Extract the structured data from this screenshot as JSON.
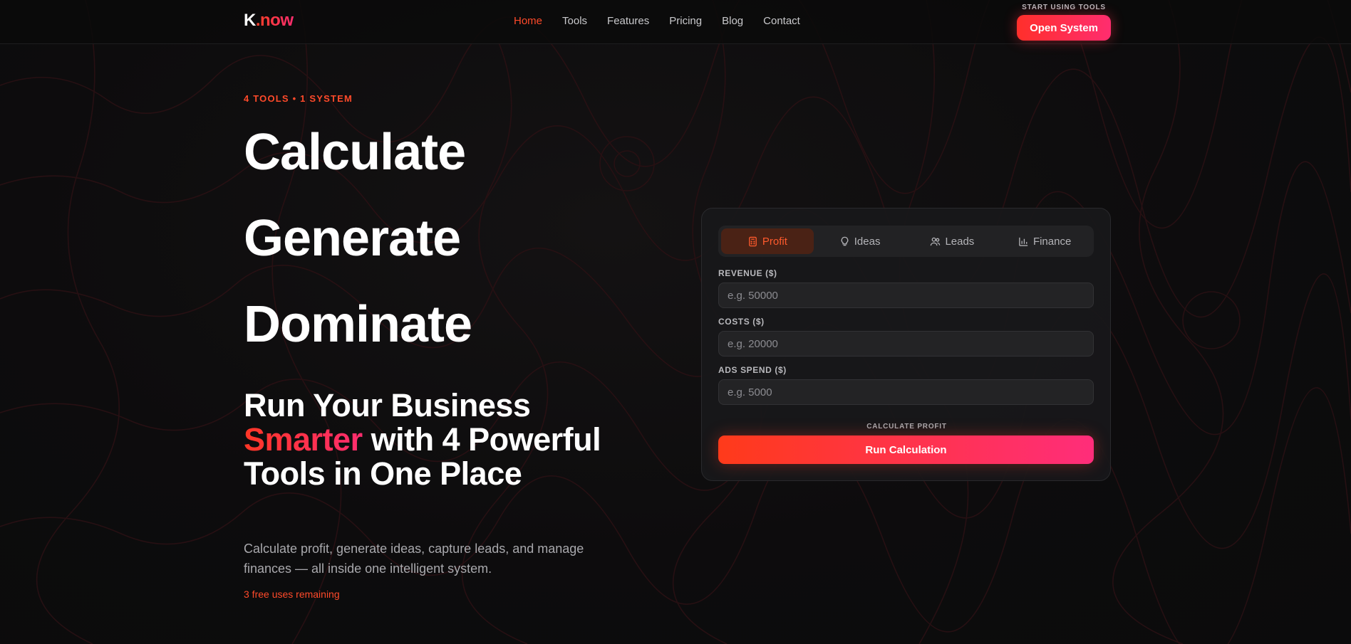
{
  "nav": {
    "logo": {
      "k": "K",
      "dot": ".",
      "now": "now"
    },
    "links": [
      {
        "label": "Home",
        "active": true
      },
      {
        "label": "Tools",
        "active": false
      },
      {
        "label": "Features",
        "active": false
      },
      {
        "label": "Pricing",
        "active": false
      },
      {
        "label": "Blog",
        "active": false
      },
      {
        "label": "Contact",
        "active": false
      }
    ],
    "cta_caption": "START USING TOOLS",
    "cta_label": "Open System"
  },
  "hero": {
    "eyebrow": "4 TOOLS • 1 SYSTEM",
    "words": [
      "Calculate",
      "Generate",
      "Dominate"
    ],
    "headline": {
      "part1": "Run Your Business ",
      "accent": "Smarter",
      "part2": " with 4 Powerful Tools in One Place"
    },
    "description": "Calculate profit, generate ideas, capture leads, and manage finances — all inside one intelligent system.",
    "remaining": "3 free uses remaining"
  },
  "tool_card": {
    "tabs": [
      {
        "label": "Profit",
        "icon": "calculator-icon",
        "active": true
      },
      {
        "label": "Ideas",
        "icon": "lightbulb-icon",
        "active": false
      },
      {
        "label": "Leads",
        "icon": "users-icon",
        "active": false
      },
      {
        "label": "Finance",
        "icon": "bar-chart-icon",
        "active": false
      }
    ],
    "fields": [
      {
        "label": "REVENUE ($)",
        "placeholder": "e.g. 50000",
        "value": ""
      },
      {
        "label": "COSTS ($)",
        "placeholder": "e.g. 20000",
        "value": ""
      },
      {
        "label": "ADS SPEND ($)",
        "placeholder": "e.g. 5000",
        "value": ""
      }
    ],
    "run_caption": "CALCULATE PROFIT",
    "run_label": "Run Calculation"
  },
  "colors": {
    "accent": "#ff4a2a",
    "accent_pink": "#ff2d6f",
    "background": "#0c0c0d"
  }
}
